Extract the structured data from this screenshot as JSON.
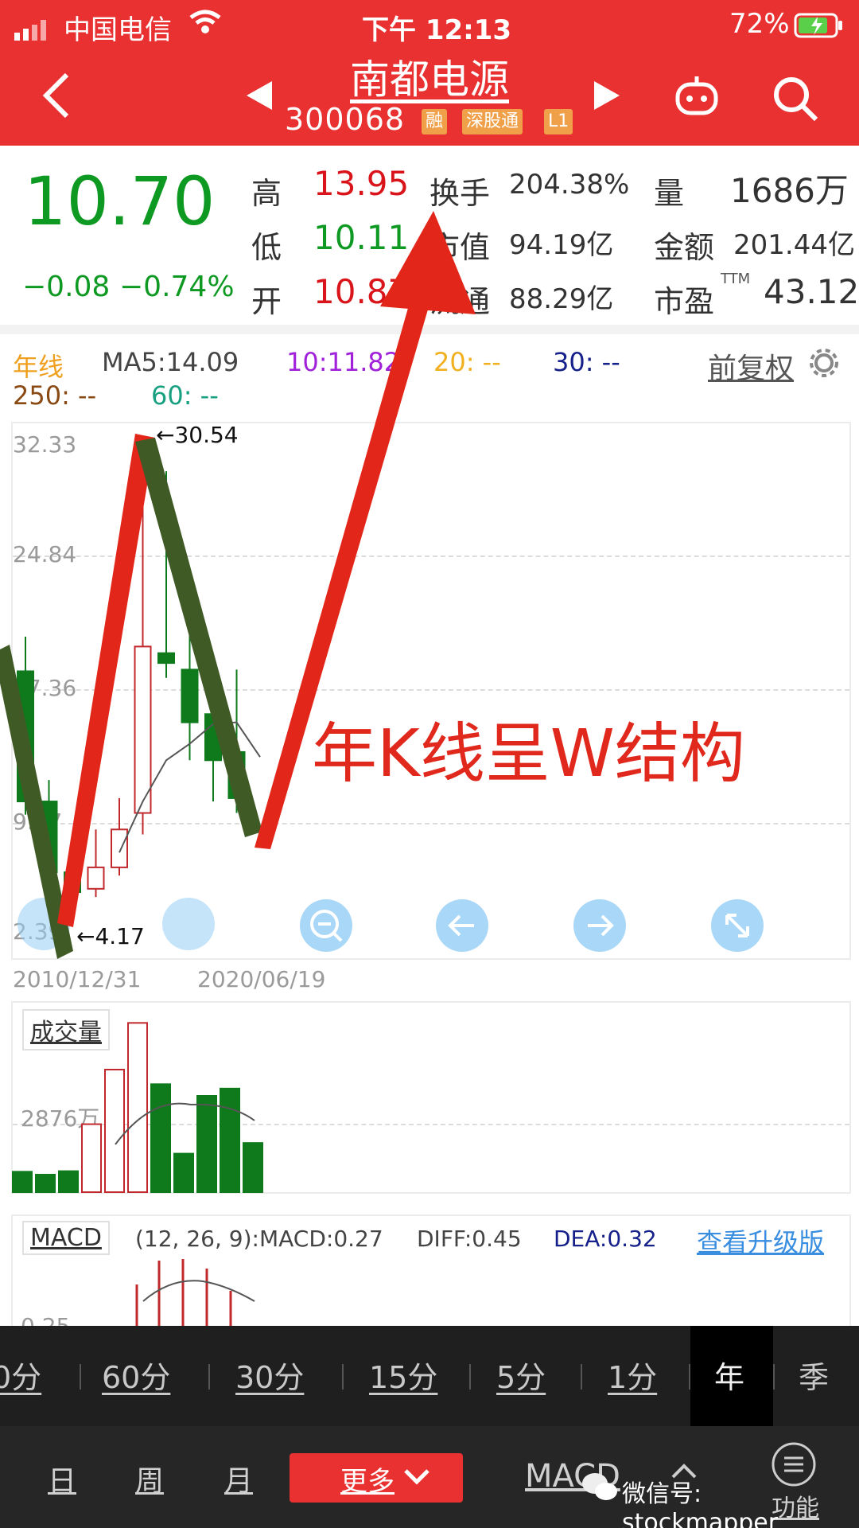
{
  "status_bar": {
    "carrier": "中国电信",
    "time": "下午 12:13",
    "battery": "72%"
  },
  "header": {
    "title": "南都电源",
    "code": "300068",
    "tags": [
      "融",
      "深股通",
      "L1"
    ]
  },
  "quote": {
    "price": "10.70",
    "change": "−0.08",
    "change_pct": "−0.74%",
    "high_label": "高",
    "high": "13.95",
    "low_label": "低",
    "low": "10.11",
    "open_label": "开",
    "open": "10.87",
    "turnover_label": "换手",
    "turnover": "204.38%",
    "mktcap_label": "市值",
    "mktcap": "94.19亿",
    "float_label": "流通",
    "float": "88.29亿",
    "vol_label": "量",
    "vol": "1686万",
    "amount_label": "金额",
    "amount": "201.44亿",
    "pe_label": "市盈",
    "pe_sup": "TTM",
    "pe": "43.12"
  },
  "legend": {
    "period": "年线",
    "ma5": "MA5:14.09",
    "ma10": "10:11.82",
    "ma20": "20: --",
    "ma30": "30: --",
    "ma250": "250: --",
    "ma60": "60: --",
    "adjust": "前复权"
  },
  "chart_data": {
    "type": "candlestick",
    "y_ticks": [
      "32.33",
      "24.84",
      "17.36",
      "9.87",
      "2.39"
    ],
    "ylim": [
      2.39,
      32.33
    ],
    "x_labels": [
      "2010/12/31",
      "2020/06/19"
    ],
    "annotations": [
      "←30.54",
      "←4.17"
    ],
    "overlay_text": "年K线呈W结构",
    "candles": [
      {
        "o": 18.4,
        "h": 20.5,
        "l": 9.7,
        "c": 10.5
      },
      {
        "o": 10.5,
        "h": 11.8,
        "l": 4.6,
        "c": 6.2
      },
      {
        "o": 6.2,
        "h": 6.9,
        "l": 4.17,
        "c": 5.0
      },
      {
        "o": 5.2,
        "h": 8.8,
        "l": 4.7,
        "c": 6.5
      },
      {
        "o": 6.5,
        "h": 10.7,
        "l": 6.0,
        "c": 8.8
      },
      {
        "o": 9.8,
        "h": 29.0,
        "l": 8.5,
        "c": 19.9
      },
      {
        "o": 19.5,
        "h": 30.54,
        "l": 18.0,
        "c": 18.9
      },
      {
        "o": 18.5,
        "h": 21.0,
        "l": 13.0,
        "c": 15.3
      },
      {
        "o": 15.8,
        "h": 19.0,
        "l": 10.5,
        "c": 13.0
      },
      {
        "o": 13.5,
        "h": 18.5,
        "l": 9.8,
        "c": 10.7
      }
    ],
    "ma_line": [
      null,
      null,
      null,
      null,
      7.4,
      10.5,
      13.0,
      14.0,
      15.2,
      15.3,
      13.2
    ],
    "volume": {
      "label": "成交量",
      "tick": "2876万",
      "values": [
        700,
        600,
        720,
        2330,
        4200,
        5800,
        3700,
        1320,
        3300,
        3550,
        1686
      ],
      "colors": [
        "g",
        "g",
        "g",
        "r",
        "r",
        "r",
        "g",
        "g",
        "g",
        "g",
        "g"
      ]
    },
    "macd": {
      "label": "MACD",
      "params": "(12, 26, 9):MACD:0.27",
      "diff": "DIFF:0.45",
      "dea": "DEA:0.32",
      "tick": "0.25",
      "upgrade": "查看升级版"
    }
  },
  "periods": [
    "0分",
    "60分",
    "30分",
    "15分",
    "5分",
    "1分",
    "年",
    "季"
  ],
  "tabs": {
    "day": "日",
    "week": "周",
    "month": "月",
    "more": "更多",
    "indicator": "MACD",
    "func": "功能"
  },
  "watermark": "微信号: stockmapper"
}
